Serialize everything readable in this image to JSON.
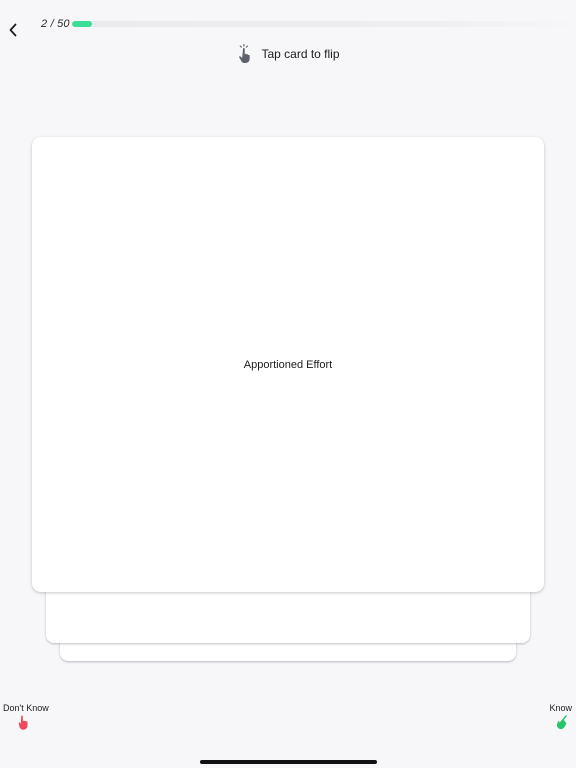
{
  "header": {
    "counter": "2 / 50",
    "progress_fraction": 0.04
  },
  "hint": {
    "icon": "tap-hand-icon",
    "text": "Tap card to flip"
  },
  "card": {
    "term": "Apportioned Effort"
  },
  "actions": {
    "dont_know": {
      "label": "Don't Know",
      "icon": "thumb-down-hand-icon",
      "color": "#f0485a"
    },
    "know": {
      "label": "Know",
      "icon": "thumb-up-hand-icon",
      "color": "#27c46a"
    }
  },
  "colors": {
    "progress": "#3ddc97",
    "background": "#f7f6f9"
  }
}
